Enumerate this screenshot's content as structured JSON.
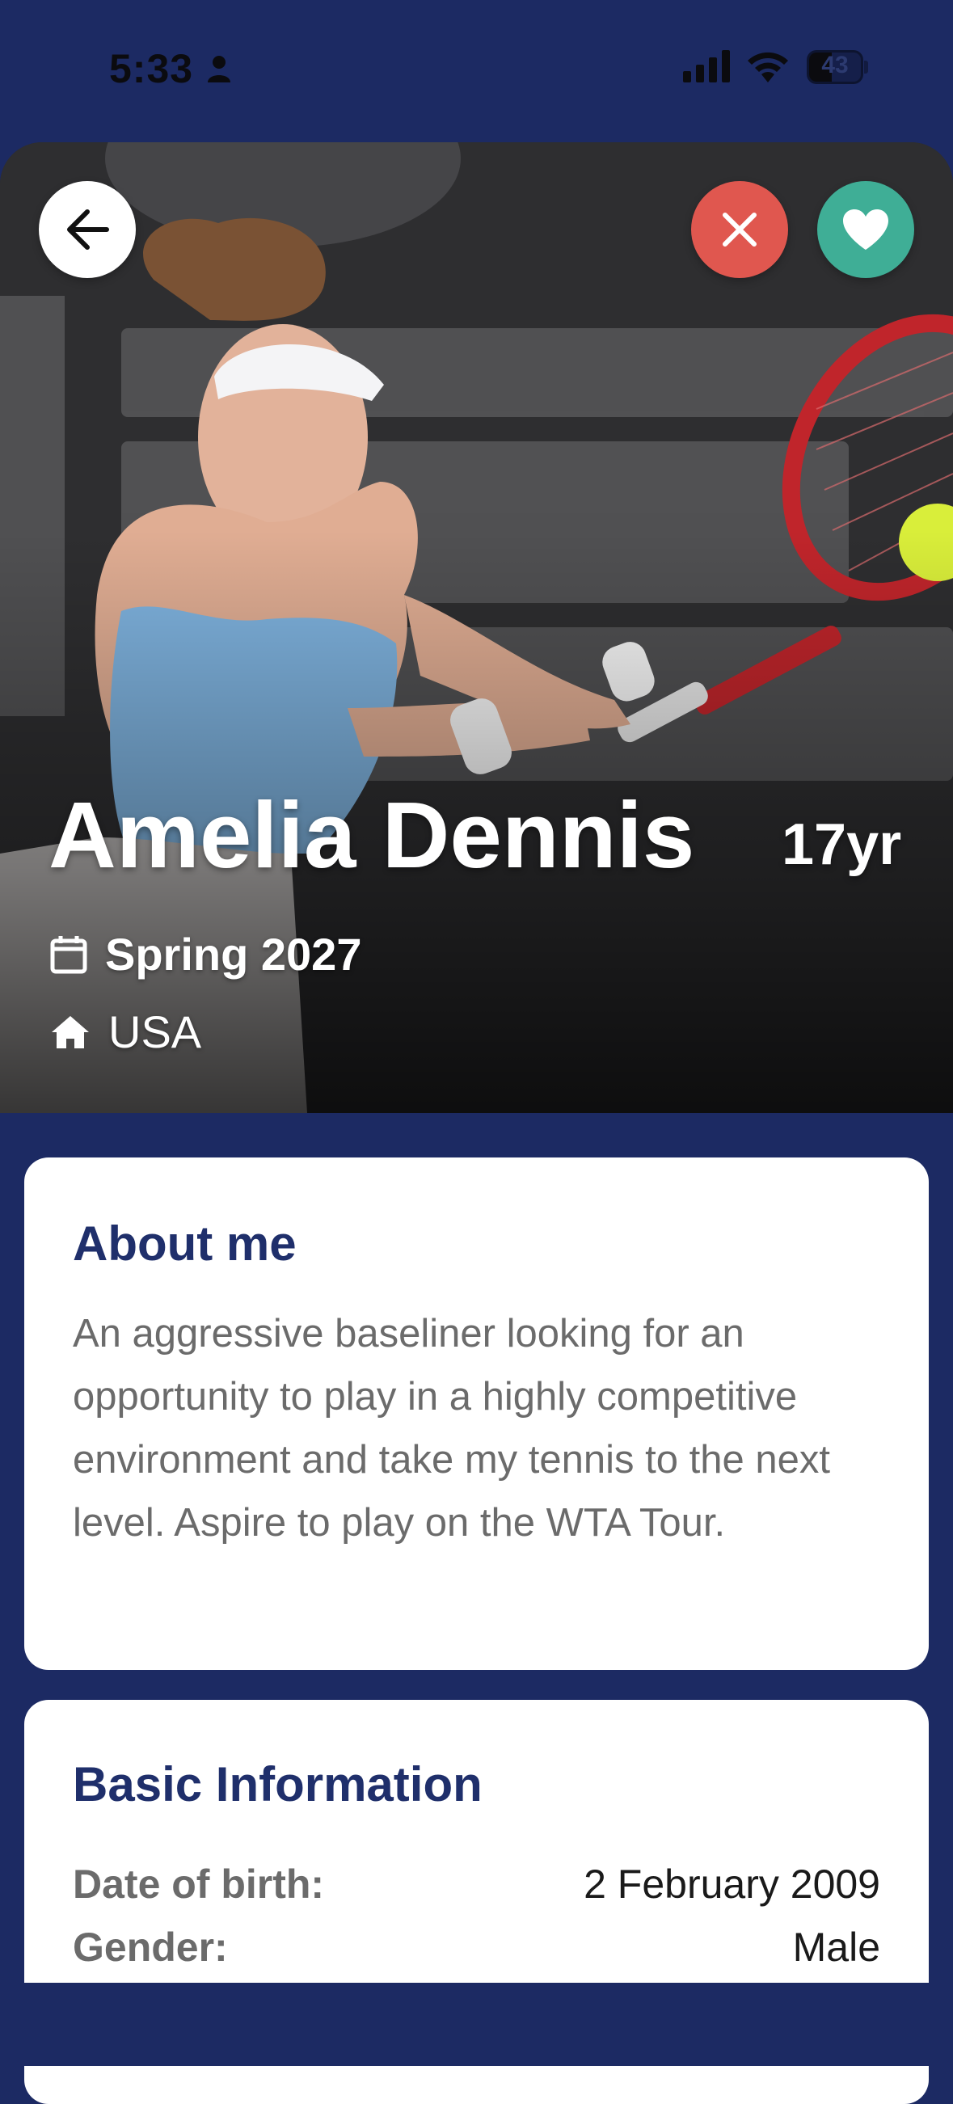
{
  "status_bar": {
    "time": "5:33",
    "battery_percent": "43",
    "battery_level": 0.43
  },
  "profile": {
    "name": "Amelia Dennis",
    "age": "17yr",
    "graduation": "Spring 2027",
    "country": "USA"
  },
  "actions": {
    "back_icon": "arrow-left-icon",
    "reject_icon": "close-icon",
    "like_icon": "heart-icon",
    "reject_color": "#e0574f",
    "like_color": "#3fae96"
  },
  "about": {
    "title": "About me",
    "text": "An aggressive baseliner looking for an opportunity to play in a highly competitive environment and take my tennis to the next level. Aspire to play on the WTA Tour."
  },
  "basic_info": {
    "title": "Basic Information",
    "rows": [
      {
        "label": "Date of birth:",
        "value": "2 February 2009"
      },
      {
        "label": "Gender:",
        "value": "Male"
      }
    ]
  },
  "theme": {
    "background": "#1c2a63",
    "title_color": "#1f2f6b"
  }
}
